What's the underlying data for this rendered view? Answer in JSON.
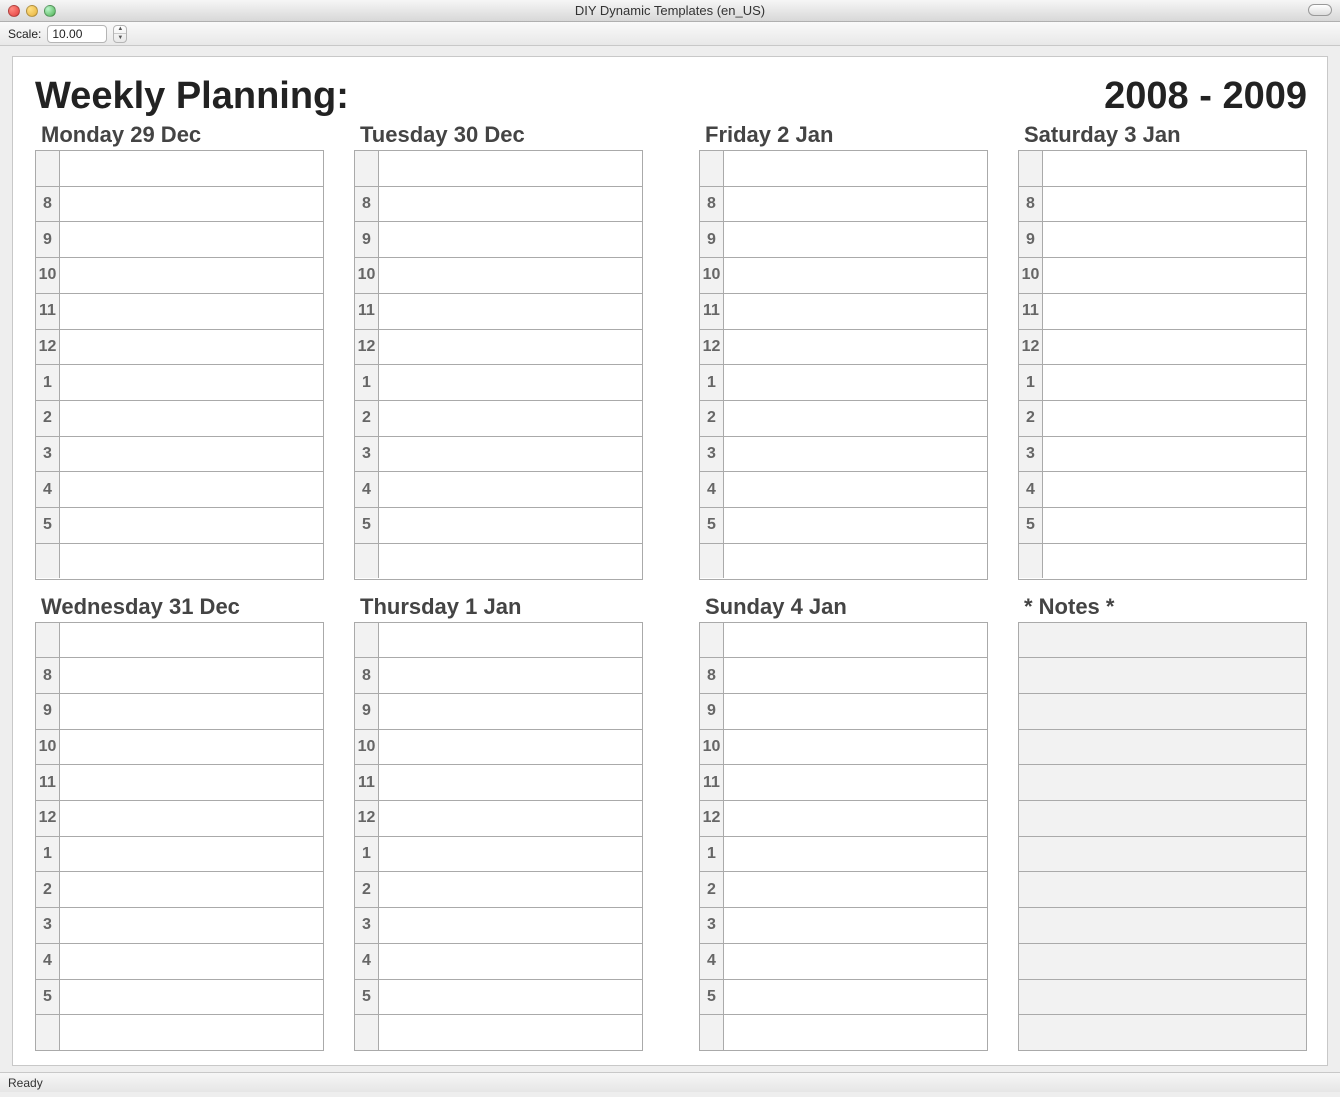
{
  "window": {
    "title": "DIY Dynamic Templates (en_US)"
  },
  "toolbar": {
    "scale_label": "Scale:",
    "scale_value": "10.00"
  },
  "planner": {
    "left_title": "Weekly Planning:",
    "right_title": "2008 - 2009",
    "hours": [
      "",
      "8",
      "9",
      "10",
      "11",
      "12",
      "1",
      "2",
      "3",
      "4",
      "5",
      ""
    ],
    "left_days": [
      {
        "label": "Monday 29 Dec"
      },
      {
        "label": "Tuesday 30 Dec"
      },
      {
        "label": "Wednesday 31 Dec"
      },
      {
        "label": "Thursday 1 Jan"
      }
    ],
    "right_days": [
      {
        "label": "Friday 2 Jan"
      },
      {
        "label": "Saturday 3 Jan"
      },
      {
        "label": "Sunday 4 Jan"
      }
    ],
    "notes_label": "* Notes *"
  },
  "status": {
    "text": "Ready"
  }
}
